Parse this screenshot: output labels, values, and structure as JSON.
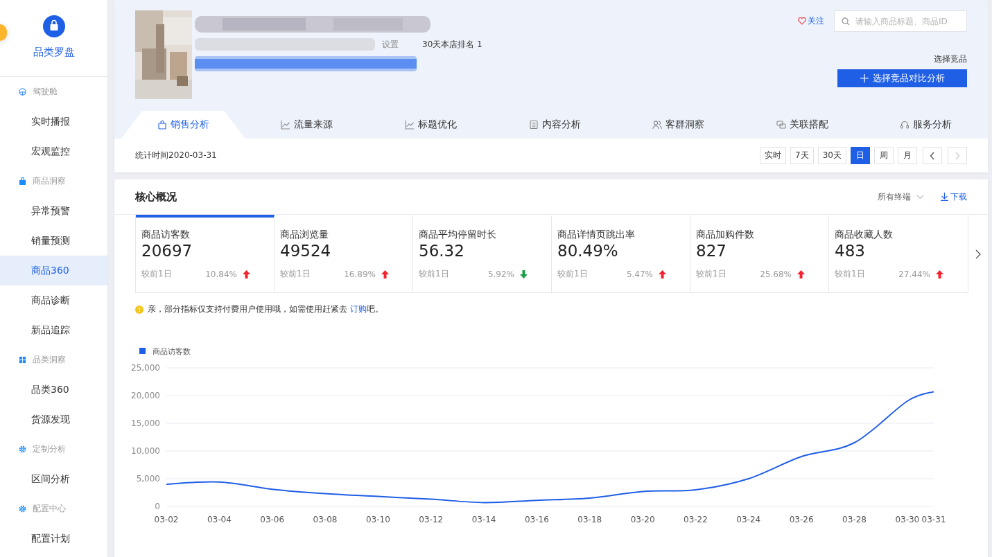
{
  "sidebar": {
    "title": "品类罗盘",
    "groups": [
      {
        "label": "驾驶舱",
        "items": [
          {
            "label": "实时播报",
            "selected": false
          },
          {
            "label": "宏观监控",
            "selected": false
          }
        ]
      },
      {
        "label": "商品洞察",
        "items": [
          {
            "label": "异常预警",
            "selected": false
          },
          {
            "label": "销量预测",
            "selected": false
          },
          {
            "label": "商品360",
            "selected": true
          },
          {
            "label": "商品诊断",
            "selected": false
          },
          {
            "label": "新品追踪",
            "selected": false
          }
        ]
      },
      {
        "label": "品类洞察",
        "items": [
          {
            "label": "品类360",
            "selected": false
          },
          {
            "label": "货源发现",
            "selected": false
          }
        ]
      },
      {
        "label": "定制分析",
        "items": [
          {
            "label": "区间分析",
            "selected": false
          }
        ]
      },
      {
        "label": "配置中心",
        "items": [
          {
            "label": "配置计划",
            "selected": false
          }
        ]
      }
    ]
  },
  "product": {
    "settings_link": "设置",
    "rank": "30天本店排名 1",
    "follow": "关注",
    "search": {
      "placeholder": "请输入商品标题、商品ID"
    },
    "compare_label": "选择竞品",
    "compare_button": "选择竞品对比分析"
  },
  "tabs": [
    {
      "label": "销售分析",
      "selected": true
    },
    {
      "label": "流量来源",
      "selected": false
    },
    {
      "label": "标题优化",
      "selected": false
    },
    {
      "label": "内容分析",
      "selected": false
    },
    {
      "label": "客群洞察",
      "selected": false
    },
    {
      "label": "关联搭配",
      "selected": false
    },
    {
      "label": "服务分析",
      "selected": false
    }
  ],
  "stat_time": "统计时间2020-03-31",
  "periods": [
    {
      "label": "实时",
      "selected": false
    },
    {
      "label": "7天",
      "selected": false
    },
    {
      "label": "30天",
      "selected": false
    },
    {
      "label": "日",
      "selected": true
    },
    {
      "label": "周",
      "selected": false
    },
    {
      "label": "月",
      "selected": false
    }
  ],
  "pager": {
    "prev_disabled": false,
    "next_disabled": true
  },
  "overview": {
    "title": "核心概况",
    "terminal": "所有终端",
    "download": "下载",
    "metrics": [
      {
        "label": "商品访客数",
        "value": "20697",
        "compare": "较前1日",
        "change": "10.84%",
        "rising": true,
        "selected": true
      },
      {
        "label": "商品浏览量",
        "value": "49524",
        "compare": "较前1日",
        "change": "16.89%",
        "rising": true,
        "selected": false
      },
      {
        "label": "商品平均停留时长",
        "value": "56.32",
        "compare": "较前1日",
        "change": "5.92%",
        "rising": false,
        "selected": false
      },
      {
        "label": "商品详情页跳出率",
        "value": "80.49%",
        "compare": "较前1日",
        "change": "5.47%",
        "rising": true,
        "selected": false
      },
      {
        "label": "商品加购件数",
        "value": "827",
        "compare": "较前1日",
        "change": "25.68%",
        "rising": true,
        "selected": false
      },
      {
        "label": "商品收藏人数",
        "value": "483",
        "compare": "较前1日",
        "change": "27.44%",
        "rising": true,
        "selected": false
      }
    ],
    "notice": "亲，部分指标仅支持付费用户使用哦，如需使用赶紧去 ",
    "notice_link": "订购",
    "notice_end": "吧。",
    "chart_data": {
      "type": "line",
      "grid": true,
      "categories": [
        "03-02",
        "03-04",
        "03-06",
        "03-08",
        "03-10",
        "03-12",
        "03-14",
        "03-16",
        "03-18",
        "03-20",
        "03-22",
        "03-24",
        "03-26",
        "03-28",
        "03-30",
        "03-31"
      ],
      "series": [
        {
          "name": "商品访客数",
          "color": "#1f5fe6",
          "values": [
            4000,
            4400,
            3100,
            2300,
            1800,
            1300,
            700,
            1100,
            1500,
            2700,
            3000,
            5000,
            9000,
            11500,
            19000,
            20700
          ]
        }
      ],
      "ylim": [
        0,
        25000
      ],
      "yticks": [
        {
          "value": 0,
          "label": "0"
        },
        {
          "value": 5000,
          "label": "5,000"
        },
        {
          "value": 10000,
          "label": "10,000"
        },
        {
          "value": 15000,
          "label": "15,000"
        },
        {
          "value": 20000,
          "label": "20,000"
        },
        {
          "value": 25000,
          "label": "25,000"
        }
      ]
    }
  }
}
